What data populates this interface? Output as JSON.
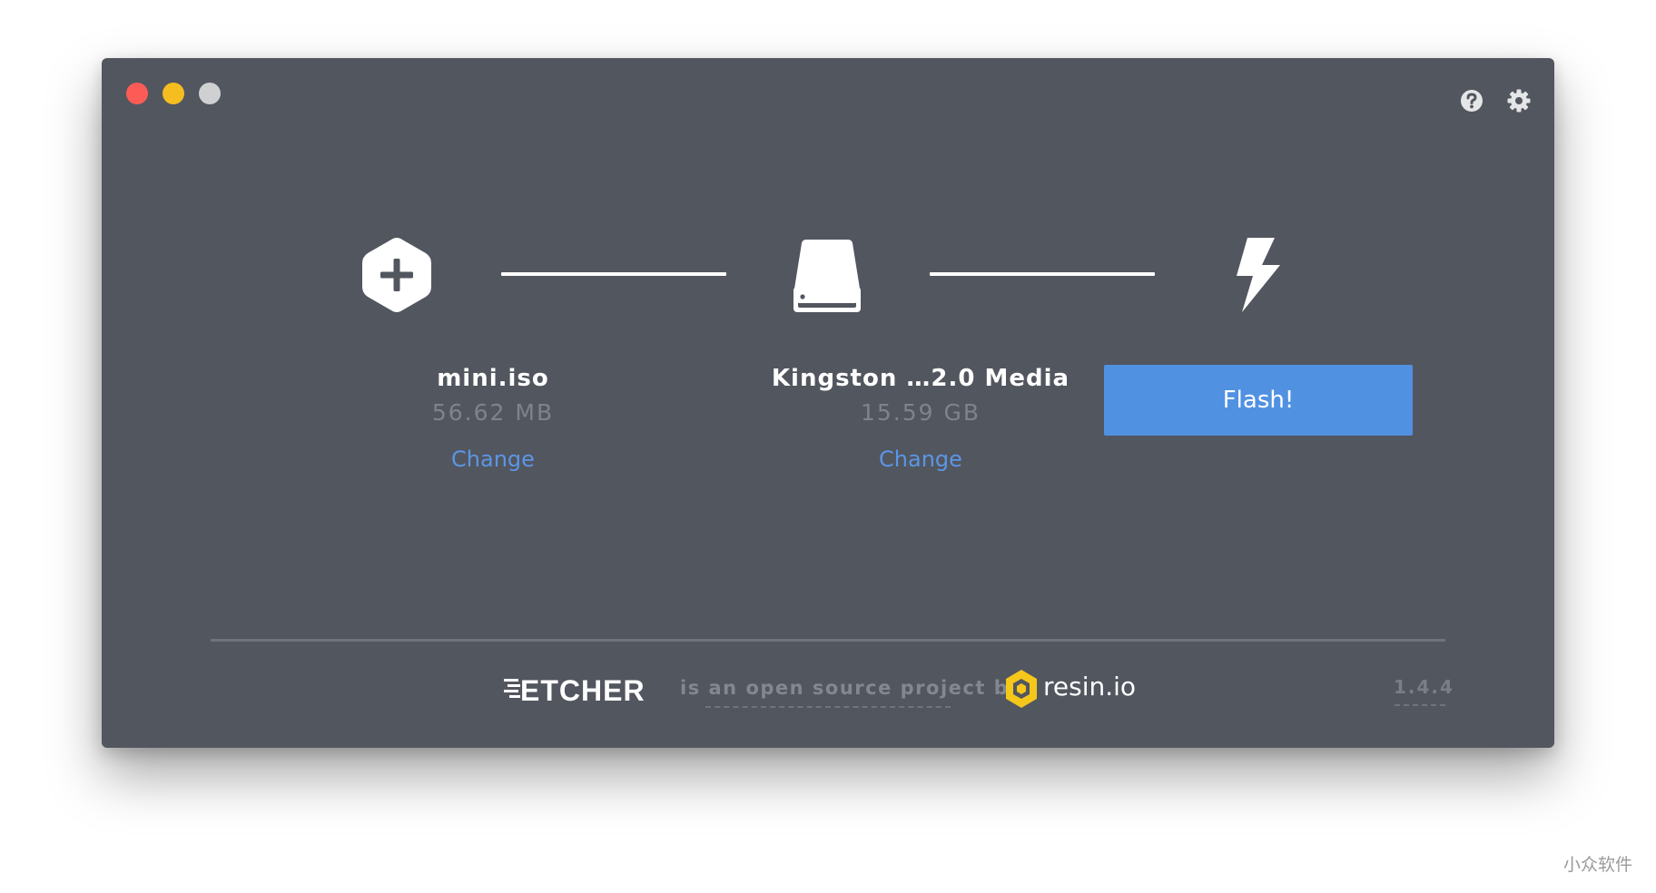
{
  "window": {
    "controls": [
      "close",
      "minimize",
      "maximize"
    ]
  },
  "toolbar": {
    "help_icon": "question-circle-icon",
    "settings_icon": "gear-icon"
  },
  "steps": {
    "image": {
      "icon": "hex-plus-icon",
      "name": "mini.iso",
      "size": "56.62 MB",
      "change_label": "Change"
    },
    "drive": {
      "icon": "drive-icon",
      "name": "Kingston …2.0 Media",
      "size": "15.59 GB",
      "change_label": "Change"
    },
    "flash": {
      "icon": "lightning-bolt-icon",
      "button_label": "Flash!"
    }
  },
  "footer": {
    "logo_text": "ETCHER",
    "tagline": "is an open source project by",
    "partner_logo_text": "resin.io",
    "version": "1.4.4"
  },
  "watermark": "小众软件",
  "colors": {
    "window_bg": "#52565f",
    "accent": "#5191e1",
    "link": "#5b96e4",
    "close": "#fd5c56",
    "minimize": "#f5bd20",
    "maximize": "#cfd0d2",
    "resin_yellow": "#f5c71a"
  }
}
